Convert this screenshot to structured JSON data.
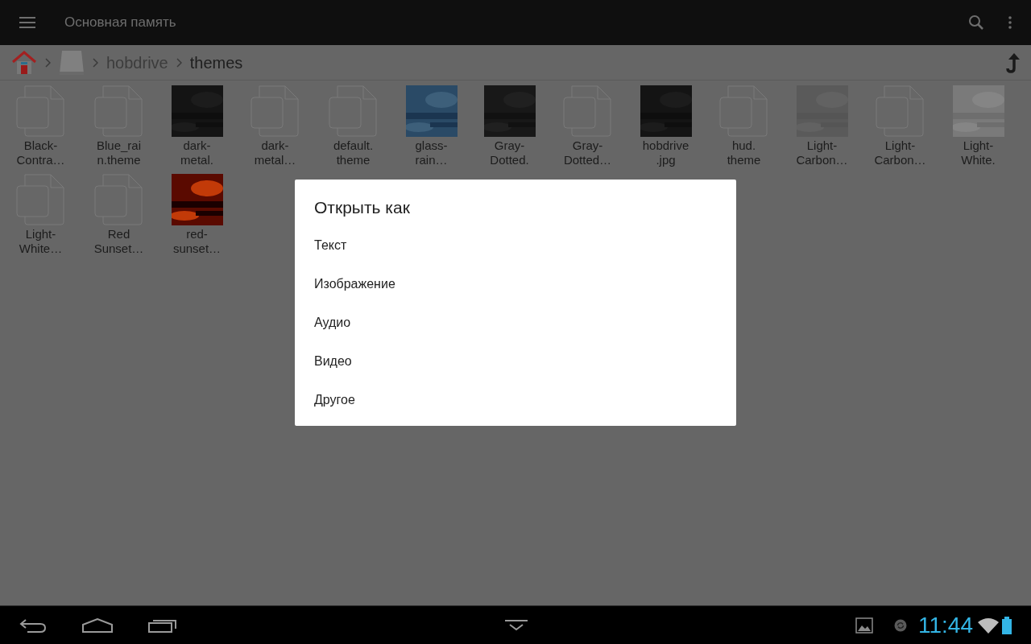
{
  "app_bar": {
    "title": "Основная память"
  },
  "breadcrumb": [
    "hobdrive",
    "themes"
  ],
  "files": [
    {
      "kind": "document",
      "lines": [
        "Black-",
        "Contra…"
      ]
    },
    {
      "kind": "document",
      "lines": [
        "Blue_rai",
        "n.theme"
      ]
    },
    {
      "kind": "picture",
      "lines": [
        "dark-",
        "metal."
      ]
    },
    {
      "kind": "document",
      "lines": [
        "dark-",
        "metal…"
      ]
    },
    {
      "kind": "document",
      "lines": [
        "default.",
        "theme"
      ]
    },
    {
      "kind": "picture",
      "lines": [
        "glass-",
        "rain…"
      ]
    },
    {
      "kind": "picture",
      "lines": [
        "Gray-",
        "Dotted."
      ]
    },
    {
      "kind": "document",
      "lines": [
        "Gray-",
        "Dotted…"
      ]
    },
    {
      "kind": "picture",
      "lines": [
        "hobdrive",
        ".jpg"
      ]
    },
    {
      "kind": "document",
      "lines": [
        "hud.",
        "theme"
      ]
    },
    {
      "kind": "picture",
      "lines": [
        "Light-",
        "Carbon…"
      ]
    },
    {
      "kind": "document",
      "lines": [
        "Light-",
        "Carbon…"
      ]
    },
    {
      "kind": "picture",
      "lines": [
        "Light-",
        "White."
      ]
    },
    {
      "kind": "document",
      "lines": [
        "Light-",
        "White…"
      ]
    },
    {
      "kind": "document",
      "lines": [
        "Red",
        "Sunset…"
      ]
    },
    {
      "kind": "picture",
      "lines": [
        "red-",
        "sunset…"
      ]
    }
  ],
  "dialog": {
    "title": "Открыть как",
    "options": [
      "Текст",
      "Изображение",
      "Аудио",
      "Видео",
      "Другое"
    ]
  },
  "status_bar": {
    "time": "11:44"
  }
}
